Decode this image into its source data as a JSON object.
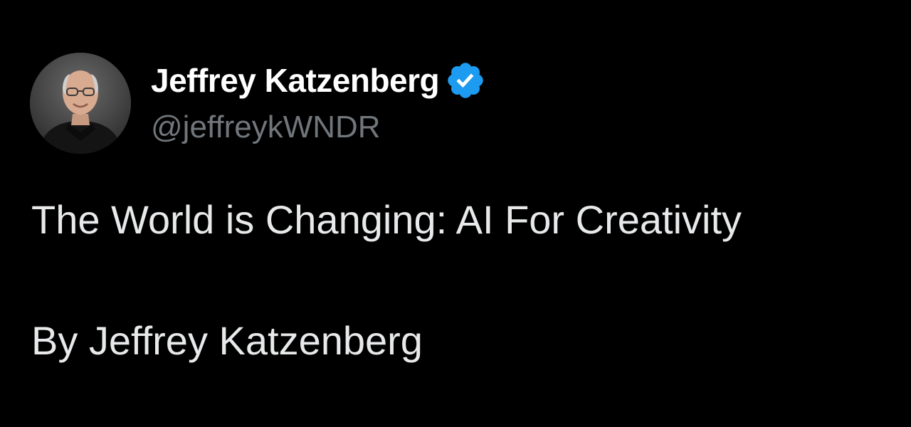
{
  "tweet": {
    "author": {
      "display_name": "Jeffrey Katzenberg",
      "handle": "@jeffreykWNDR",
      "verified": true,
      "verified_color": "#1d9bf0",
      "avatar_icon": "profile-photo"
    },
    "body_lines": [
      "The World is Changing: AI For Creativity",
      "By Jeffrey Katzenberg"
    ]
  },
  "colors": {
    "background": "#000000",
    "primary_text": "#e7e9ea",
    "secondary_text": "#71767b"
  }
}
